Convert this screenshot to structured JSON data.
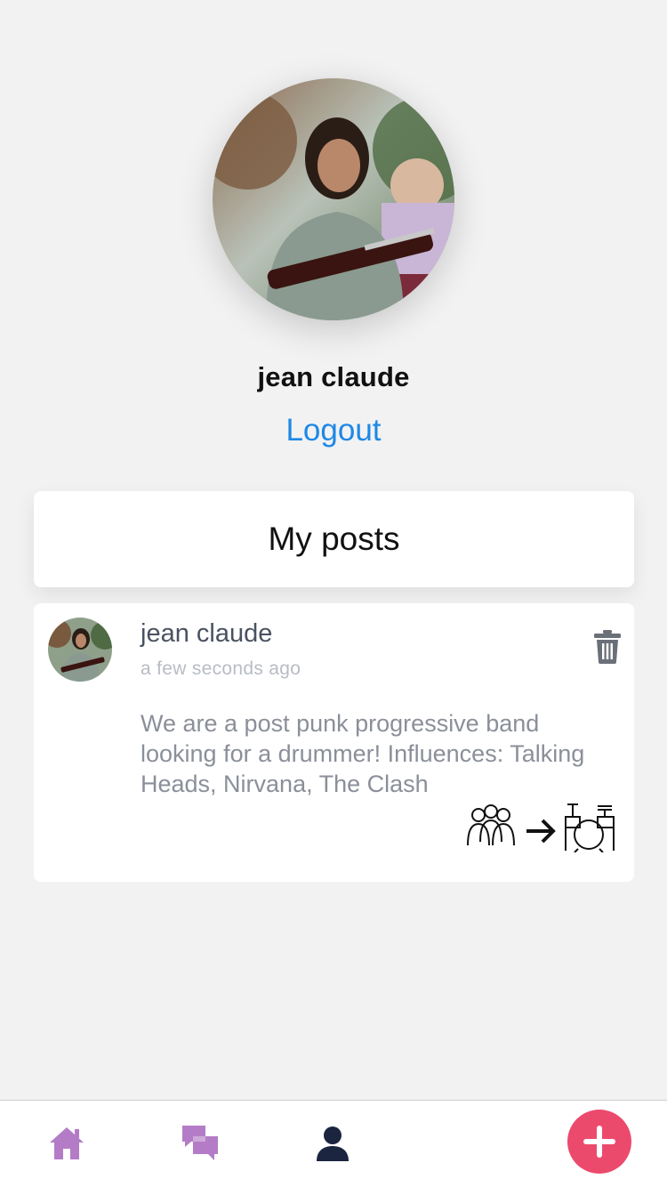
{
  "profile": {
    "name": "jean claude",
    "logout_label": "Logout"
  },
  "posts_section": {
    "title": "My posts"
  },
  "posts": [
    {
      "author": "jean claude",
      "time": "a few seconds ago",
      "body": "We are a post punk progressive band looking for a drummer! Influences: Talking Heads, Nirvana, The Clash",
      "tag_icons": [
        "band-members-icon",
        "arrow-right-icon",
        "drum-kit-icon"
      ]
    }
  ],
  "bottom_nav": {
    "items": [
      {
        "icon": "home-icon",
        "active": false
      },
      {
        "icon": "chat-icon",
        "active": false
      },
      {
        "icon": "profile-icon",
        "active": true
      }
    ],
    "fab_icon": "plus-icon"
  },
  "colors": {
    "accent": "#1e88e5",
    "fab": "#ec4a6d",
    "nav_inactive": "#b47cc7",
    "nav_active": "#1b2540",
    "background": "#f2f2f2"
  }
}
